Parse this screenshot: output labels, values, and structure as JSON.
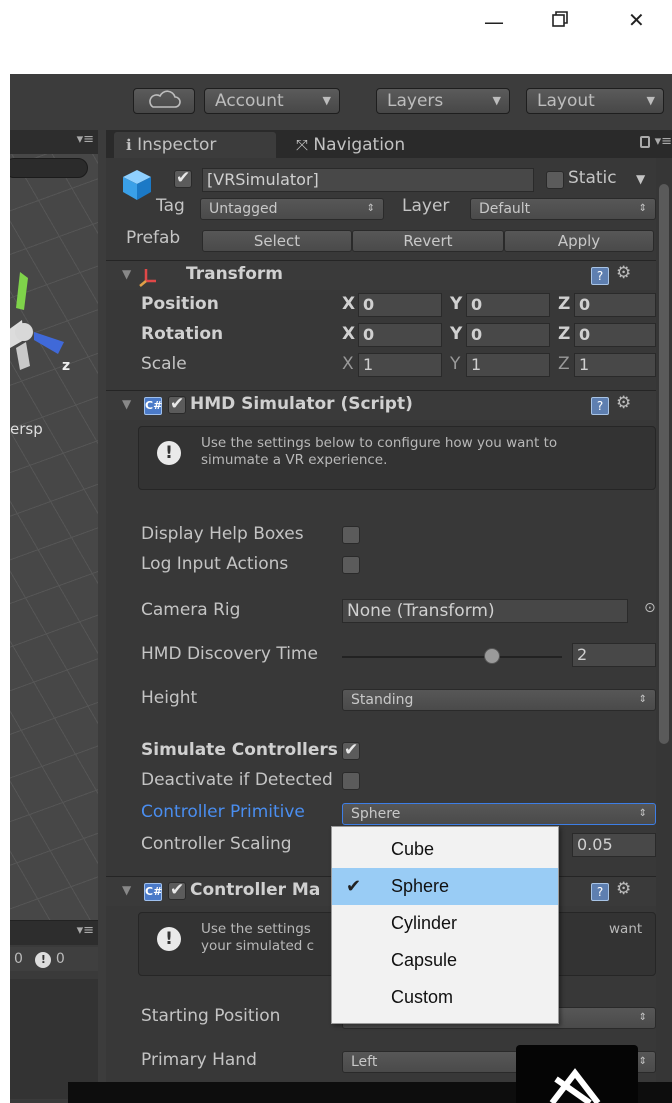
{
  "toolbar": {
    "account": "Account",
    "layers": "Layers",
    "layout": "Layout"
  },
  "scene": {
    "axis_z": "z",
    "persp_label": "ersp"
  },
  "console": {
    "counter": "0",
    "error_count": "0"
  },
  "tabs": {
    "inspector": "Inspector",
    "navigation": "Navigation"
  },
  "object": {
    "name": "[VRSimulator]",
    "static_label": "Static",
    "tag_label": "Tag",
    "tag_value": "Untagged",
    "layer_label": "Layer",
    "layer_value": "Default",
    "prefab_label": "Prefab",
    "prefab_select": "Select",
    "prefab_revert": "Revert",
    "prefab_apply": "Apply"
  },
  "transform": {
    "title": "Transform",
    "position_label": "Position",
    "rotation_label": "Rotation",
    "scale_label": "Scale",
    "x": "X",
    "y": "Y",
    "z": "Z",
    "position": [
      "0",
      "0",
      "0"
    ],
    "rotation": [
      "0",
      "0",
      "0"
    ],
    "scale": [
      "1",
      "1",
      "1"
    ]
  },
  "hmd": {
    "title": "HMD Simulator (Script)",
    "help_text_line1": "Use the settings below to configure how you want to",
    "help_text_line2": "simumate a VR experience.",
    "display_help_label": "Display Help Boxes",
    "log_input_label": "Log Input Actions",
    "camera_rig_label": "Camera Rig",
    "camera_rig_value": "None (Transform)",
    "discovery_label": "HMD Discovery Time",
    "discovery_value": "2",
    "discovery_fraction": 0.68,
    "height_label": "Height",
    "height_value": "Standing",
    "simulate_label": "Simulate Controllers",
    "deactivate_label": "Deactivate if Detected",
    "primitive_label": "Controller Primitive",
    "primitive_value": "Sphere",
    "scaling_label": "Controller Scaling",
    "scaling_value": "0.05"
  },
  "controller_manager": {
    "title": "Controller Ma",
    "help_line1": "Use the settings",
    "help_line1_tail": "want",
    "help_line2": "your simulated c",
    "starting_position_label": "Starting Position",
    "primary_hand_label": "Primary Hand",
    "primary_hand_value": "Left"
  },
  "dropdown": {
    "items": [
      "Cube",
      "Sphere",
      "Cylinder",
      "Capsule",
      "Custom"
    ],
    "selected": "Sphere"
  },
  "colors": {
    "accent_blue": "#4a8ef0",
    "selection": "#99ccf5",
    "panel": "#383838"
  }
}
